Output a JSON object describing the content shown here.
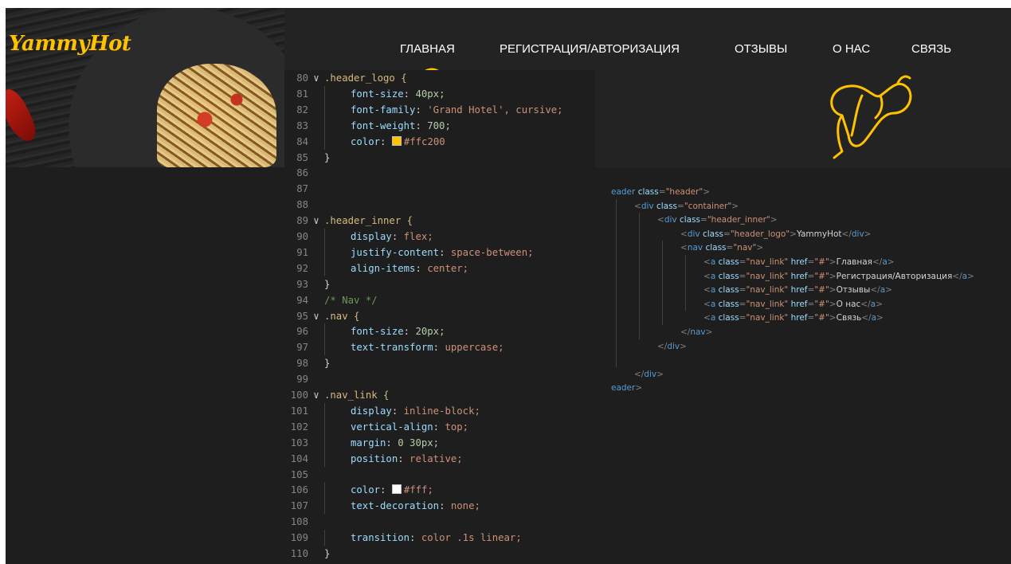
{
  "site": {
    "logo": "YammyHot",
    "nav": [
      "ГЛАВНАЯ",
      "РЕГИСТРАЦИЯ/АВТОРИЗАЦИЯ",
      "ОТЗЫВЫ",
      "О НАС",
      "СВЯЗЬ"
    ],
    "icons": [
      "pepper-icon"
    ],
    "colors": {
      "logo": "#ffc200",
      "background": "#232323"
    }
  },
  "css_editor": {
    "lines": [
      {
        "n": "80",
        "fold": true,
        "sel": ".header_logo {"
      },
      {
        "n": "81",
        "prop": "font-size",
        "val": "40px;"
      },
      {
        "n": "82",
        "prop": "font-family",
        "val": "'Grand Hotel', cursive;"
      },
      {
        "n": "83",
        "prop": "font-weight",
        "val": "700;"
      },
      {
        "n": "84",
        "prop": "color",
        "val": "#ffc200",
        "swatch": "#ffc200"
      },
      {
        "n": "85",
        "close": "}"
      },
      {
        "n": "86"
      },
      {
        "n": "87"
      },
      {
        "n": "88"
      },
      {
        "n": "89",
        "fold": true,
        "sel": ".header_inner {"
      },
      {
        "n": "90",
        "prop": "display",
        "val": "flex;"
      },
      {
        "n": "91",
        "prop": "justify-content",
        "val": "space-between;"
      },
      {
        "n": "92",
        "prop": "align-items",
        "val": "center;"
      },
      {
        "n": "93",
        "close": "}"
      },
      {
        "n": "94",
        "comment": "/* Nav */"
      },
      {
        "n": "95",
        "fold": true,
        "sel": ".nav {"
      },
      {
        "n": "96",
        "prop": "font-size",
        "val": "20px;"
      },
      {
        "n": "97",
        "prop": "text-transform",
        "val": "uppercase;"
      },
      {
        "n": "98",
        "close": "}"
      },
      {
        "n": "99"
      },
      {
        "n": "100",
        "fold": true,
        "sel": ".nav_link {"
      },
      {
        "n": "101",
        "prop": "display",
        "val": "inline-block;"
      },
      {
        "n": "102",
        "prop": "vertical-align",
        "val": "top;"
      },
      {
        "n": "103",
        "prop": "margin",
        "val": "0 30px;"
      },
      {
        "n": "104",
        "prop": "position",
        "val": "relative;"
      },
      {
        "n": "105"
      },
      {
        "n": "106",
        "prop": "color",
        "val": "#fff;",
        "swatch": "#ffffff"
      },
      {
        "n": "107",
        "prop": "text-decoration",
        "val": "none;"
      },
      {
        "n": "108"
      },
      {
        "n": "109",
        "prop": "transition",
        "val": "color .1s linear;"
      },
      {
        "n": "110",
        "close": "}"
      }
    ]
  },
  "html_editor": {
    "lines": [
      {
        "depth": 0,
        "parts": [
          [
            "tag",
            "eader "
          ],
          [
            "attr",
            "class"
          ],
          [
            "punct",
            "="
          ],
          [
            "aval",
            "\"header\""
          ],
          [
            "punct",
            ">"
          ]
        ]
      },
      {
        "depth": 1,
        "parts": [
          [
            "punct",
            "<"
          ],
          [
            "tag",
            "div "
          ],
          [
            "attr",
            "class"
          ],
          [
            "punct",
            "="
          ],
          [
            "aval",
            "\"container\""
          ],
          [
            "punct",
            ">"
          ]
        ]
      },
      {
        "depth": 2,
        "parts": [
          [
            "punct",
            "<"
          ],
          [
            "tag",
            "div "
          ],
          [
            "attr",
            "class"
          ],
          [
            "punct",
            "="
          ],
          [
            "aval",
            "\"header_inner\""
          ],
          [
            "punct",
            ">"
          ]
        ]
      },
      {
        "depth": 3,
        "parts": [
          [
            "punct",
            "<"
          ],
          [
            "tag",
            "div "
          ],
          [
            "attr",
            "class"
          ],
          [
            "punct",
            "="
          ],
          [
            "aval",
            "\"header_logo\""
          ],
          [
            "punct",
            ">"
          ],
          [
            "txt",
            "YammyHot"
          ],
          [
            "punct",
            "</"
          ],
          [
            "tag",
            "div"
          ],
          [
            "punct",
            ">"
          ]
        ]
      },
      {
        "depth": 3,
        "parts": [
          [
            "punct",
            "<"
          ],
          [
            "tag",
            "nav "
          ],
          [
            "attr",
            "class"
          ],
          [
            "punct",
            "="
          ],
          [
            "aval",
            "\"nav\""
          ],
          [
            "punct",
            ">"
          ]
        ]
      },
      {
        "depth": 4,
        "parts": [
          [
            "punct",
            "<"
          ],
          [
            "tag",
            "a "
          ],
          [
            "attr",
            "class"
          ],
          [
            "punct",
            "="
          ],
          [
            "aval",
            "\"nav_link\" "
          ],
          [
            "attr",
            "href"
          ],
          [
            "punct",
            "="
          ],
          [
            "aval",
            "\"#\""
          ],
          [
            "punct",
            ">"
          ],
          [
            "txt",
            "Главная"
          ],
          [
            "punct",
            "</"
          ],
          [
            "tag",
            "a"
          ],
          [
            "punct",
            ">"
          ]
        ]
      },
      {
        "depth": 4,
        "parts": [
          [
            "punct",
            "<"
          ],
          [
            "tag",
            "a "
          ],
          [
            "attr",
            "class"
          ],
          [
            "punct",
            "="
          ],
          [
            "aval",
            "\"nav_link\" "
          ],
          [
            "attr",
            "href"
          ],
          [
            "punct",
            "="
          ],
          [
            "aval",
            "\"#\""
          ],
          [
            "punct",
            ">"
          ],
          [
            "txt",
            "Регистрация/Авторизация"
          ],
          [
            "punct",
            "</"
          ],
          [
            "tag",
            "a"
          ],
          [
            "punct",
            ">"
          ]
        ]
      },
      {
        "depth": 4,
        "parts": [
          [
            "punct",
            "<"
          ],
          [
            "tag",
            "a "
          ],
          [
            "attr",
            "class"
          ],
          [
            "punct",
            "="
          ],
          [
            "aval",
            "\"nav_link\" "
          ],
          [
            "attr",
            "href"
          ],
          [
            "punct",
            "="
          ],
          [
            "aval",
            "\"#\""
          ],
          [
            "punct",
            ">"
          ],
          [
            "txt",
            "Отзывы"
          ],
          [
            "punct",
            "</"
          ],
          [
            "tag",
            "a"
          ],
          [
            "punct",
            ">"
          ]
        ]
      },
      {
        "depth": 4,
        "parts": [
          [
            "punct",
            "<"
          ],
          [
            "tag",
            "a "
          ],
          [
            "attr",
            "class"
          ],
          [
            "punct",
            "="
          ],
          [
            "aval",
            "\"nav_link\" "
          ],
          [
            "attr",
            "href"
          ],
          [
            "punct",
            "="
          ],
          [
            "aval",
            "\"#\""
          ],
          [
            "punct",
            ">"
          ],
          [
            "txt",
            "О нас"
          ],
          [
            "punct",
            "</"
          ],
          [
            "tag",
            "a"
          ],
          [
            "punct",
            ">"
          ]
        ]
      },
      {
        "depth": 4,
        "parts": [
          [
            "punct",
            "<"
          ],
          [
            "tag",
            "a "
          ],
          [
            "attr",
            "class"
          ],
          [
            "punct",
            "="
          ],
          [
            "aval",
            "\"nav_link\" "
          ],
          [
            "attr",
            "href"
          ],
          [
            "punct",
            "="
          ],
          [
            "aval",
            "\"#\""
          ],
          [
            "punct",
            ">"
          ],
          [
            "txt",
            "Связь"
          ],
          [
            "punct",
            "</"
          ],
          [
            "tag",
            "a"
          ],
          [
            "punct",
            ">"
          ]
        ]
      },
      {
        "depth": 3,
        "parts": [
          [
            "punct",
            "</"
          ],
          [
            "tag",
            "nav"
          ],
          [
            "punct",
            ">"
          ]
        ]
      },
      {
        "depth": 2,
        "parts": [
          [
            "punct",
            "</"
          ],
          [
            "tag",
            "div"
          ],
          [
            "punct",
            ">"
          ]
        ]
      },
      {
        "depth": 1,
        "parts": []
      },
      {
        "depth": 1,
        "parts": [
          [
            "punct",
            "</"
          ],
          [
            "tag",
            "div"
          ],
          [
            "punct",
            ">"
          ]
        ]
      },
      {
        "depth": 0,
        "parts": [
          [
            "tag",
            "eader"
          ],
          [
            "punct",
            ">"
          ]
        ]
      }
    ]
  }
}
